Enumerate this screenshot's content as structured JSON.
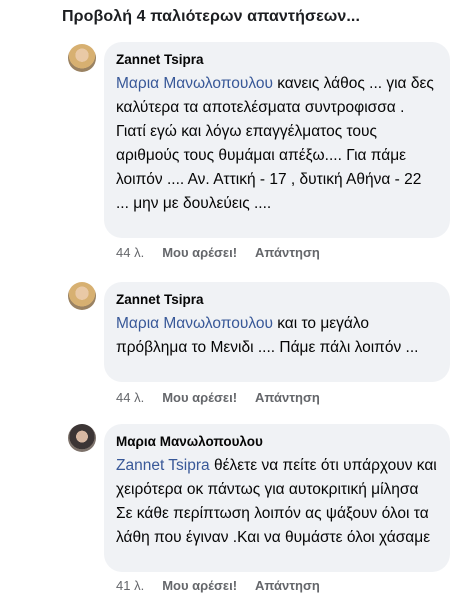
{
  "view_more_label": "Προβολή 4 παλιότερων απαντήσεων...",
  "comments": [
    {
      "author": "Zannet Tsipra",
      "mention": "Μαρια Μανωλοπουλου",
      "text": " κανεις λάθος ... για δες καλύτερα τα αποτελέσματα συντροφισσα . Γιατί εγώ και λόγω επαγγέλματος τους αριθμούς τους θυμάμαι απέξω.... Για πάμε λοιπόν .... Αν. Αττική - 17 , δυτική Αθήνα - 22 ... μην με δουλεύεις ....",
      "time": "44 λ.",
      "like_label": "Μου αρέσει!",
      "reply_label": "Απάντηση"
    },
    {
      "author": "Zannet Tsipra",
      "mention": "Μαρια Μανωλοπουλου",
      "text": " και το μεγάλο πρόβλημα το Μενιδι .... Πάμε πάλι λοιπόν ...",
      "time": "44 λ.",
      "like_label": "Μου αρέσει!",
      "reply_label": "Απάντηση"
    },
    {
      "author": "Μαρια Μανωλοπουλου",
      "mention": "Zannet Tsipra",
      "text": " θέλετε να πείτε ότι υπάρχουν και χειρότερα οκ πάντως για αυτοκριτική μίλησα Σε κάθε περίπτωση λοιπόν ας ψάξουν όλοι τα λάθη που έγιναν .Και να θυμάστε όλοι χάσαμε",
      "time": "41 λ.",
      "like_label": "Μου αρέσει!",
      "reply_label": "Απάντηση"
    }
  ]
}
